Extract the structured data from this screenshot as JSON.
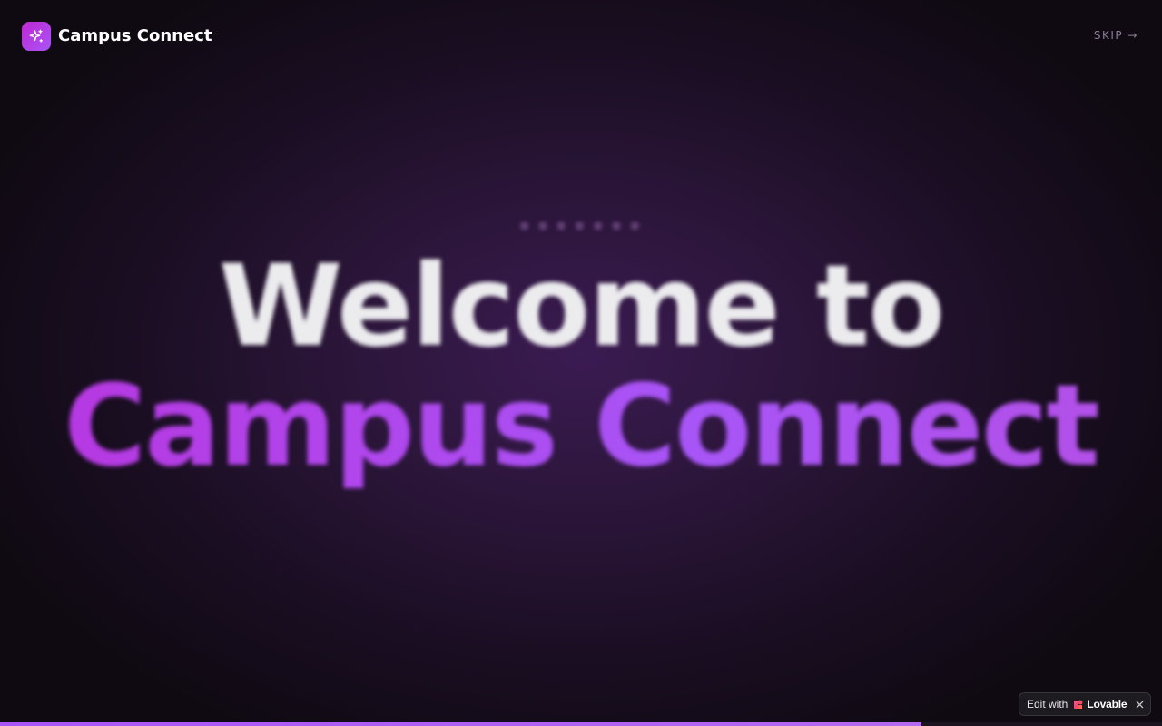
{
  "header": {
    "brand_name": "Campus Connect",
    "logo_icon": "sparkles-icon",
    "skip_label": "SKIP →"
  },
  "hero": {
    "kicker": "● ● ● ● ● ● ●",
    "title_line1": "Welcome to",
    "title_line2": "Campus Connect"
  },
  "progress": {
    "fraction": 0.793
  },
  "lovable_badge": {
    "edit_label": "Edit with",
    "brand": "Lovable",
    "close_icon": "close-icon"
  },
  "colors": {
    "accent": "#a855f7",
    "accent_pink": "#c026d3",
    "background": "#0f0a12"
  }
}
